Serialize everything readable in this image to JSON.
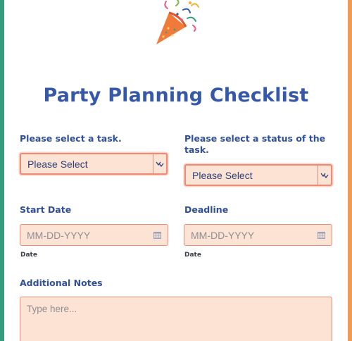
{
  "page": {
    "title": "Party Planning Checklist",
    "accent_left": "#3a9b7c",
    "accent_right": "#f39a52",
    "title_color": "#3558a8",
    "field_bg": "#fde3d3",
    "field_border": "#ee8a78",
    "header_icon": "party-popper-icon"
  },
  "form": {
    "task": {
      "label": "Please select a task.",
      "selected": "Please Select"
    },
    "status": {
      "label": "Please select a status of the task.",
      "selected": "Please Select"
    },
    "start_date": {
      "label": "Start Date",
      "placeholder": "MM-DD-YYYY",
      "sublabel": "Date"
    },
    "deadline": {
      "label": "Deadline",
      "placeholder": "MM-DD-YYYY",
      "sublabel": "Date"
    },
    "notes": {
      "label": "Additional Notes",
      "placeholder": "Type here..."
    }
  }
}
